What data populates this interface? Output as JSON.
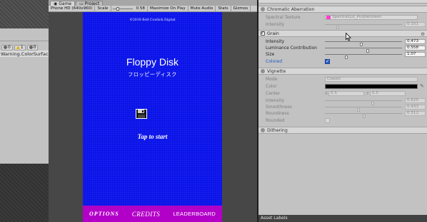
{
  "console": {
    "error_count": "0",
    "warning_count": "1",
    "message_count": "0",
    "message": "Warning.ColorSurface"
  },
  "tabs": [
    {
      "label": "Game",
      "icon": "game-icon"
    },
    {
      "label": "Project",
      "icon": "folder-icon"
    }
  ],
  "game_toolbar": {
    "resolution": "Phone HD (640x960)",
    "scale_label": "Scale",
    "scale_value": "0.58",
    "maximize_on_play": "Maximize On Play",
    "mute_audio": "Mute Audio",
    "stats": "Stats",
    "gizmos": "Gizmos",
    "scale_fraction": 0.2
  },
  "game": {
    "copyright": "©2018 Bolt Cowlick Digital",
    "title": "Floppy Disk",
    "subtitle": "フロッピーディスク",
    "tap_to_start": "Tap to start",
    "menu": {
      "options": "OPTIONS",
      "credits": "CREDITS",
      "leaderboard": "LEADERBOARD"
    },
    "colors": {
      "background": "#0912e8",
      "menu_bar": "#b300c8"
    }
  },
  "inspector": {
    "chromatic": {
      "title": "Chromatic Aberration",
      "spectral_label": "Spectral Texture",
      "spectral_value": "SpectralLut_PurpleGreen",
      "intensity_label": "Intensity",
      "intensity_value": "0.151",
      "intensity_fraction": 0.151
    },
    "grain": {
      "title": "Grain",
      "intensity_label": "Intensity",
      "intensity_value": "0.473",
      "intensity_fraction": 0.473,
      "luminance_label": "Luminance Contribution",
      "luminance_value": "0.558",
      "luminance_fraction": 0.558,
      "size_label": "Size",
      "size_value": "1.07",
      "size_fraction": 0.27,
      "colored_label": "Colored"
    },
    "vignette": {
      "title": "Vignette",
      "mode_label": "Mode",
      "mode_value": "Classic",
      "color_label": "Color",
      "center_label": "Center",
      "center_x_label": "X",
      "center_x": "0.5",
      "center_y_label": "Y",
      "center_y": "0.5",
      "intensity_label": "Intensity",
      "intensity_value": "0.625",
      "intensity_fraction": 0.625,
      "smoothness_label": "Smoothness",
      "smoothness_value": "0.433",
      "smoothness_fraction": 0.433,
      "roundness_label": "Roundness",
      "roundness_value": "0.512",
      "roundness_fraction": 0.512,
      "rounded_label": "Rounded"
    },
    "dithering": {
      "title": "Dithering"
    },
    "asset_labels": "Asset Labels"
  }
}
